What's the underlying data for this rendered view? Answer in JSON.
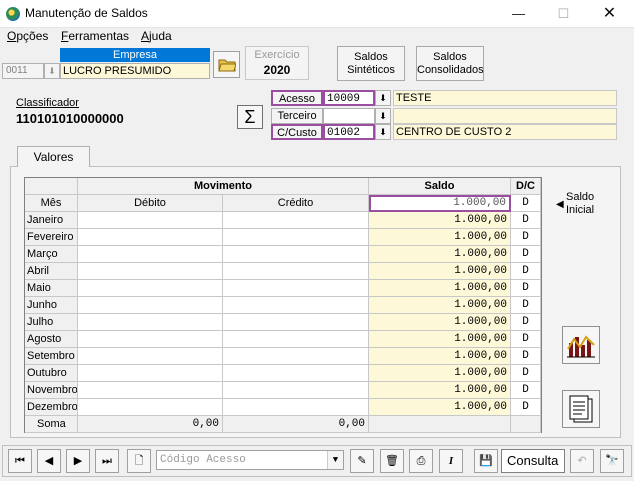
{
  "window": {
    "title": "Manutenção de Saldos",
    "min_symbol": "—",
    "max_symbol": "☐",
    "close_symbol": "✕"
  },
  "menu": {
    "items": [
      {
        "first": "O",
        "rest": "pções"
      },
      {
        "first": "F",
        "rest": "erramentas"
      },
      {
        "first": "A",
        "rest": "juda"
      }
    ]
  },
  "empresa": {
    "header": "Empresa",
    "code": "0011",
    "name": "LUCRO PRESUMIDO"
  },
  "exercicio": {
    "label": "Exercício",
    "value": "2020"
  },
  "buttons": {
    "saldos_sinteticos": [
      "Saldos",
      "Sintéticos"
    ],
    "saldos_consolidados": [
      "Saldos",
      "Consolidados"
    ]
  },
  "classificador": {
    "label": "Classificador",
    "value": "110101010000000",
    "sigma": "Σ"
  },
  "fields": {
    "acesso": {
      "label": "Acesso",
      "value": "10009",
      "desc": "TESTE"
    },
    "terceiro": {
      "label": "Terceiro",
      "value": "",
      "desc": ""
    },
    "ccusto": {
      "label": "C/Custo",
      "value": "01002",
      "desc": "CENTRO DE CUSTO 2"
    }
  },
  "tabs": {
    "valores": "Valores"
  },
  "grid": {
    "group_headers": {
      "movimento": "Movimento",
      "saldo": "Saldo",
      "dc": "D/C"
    },
    "columns": {
      "mes": "Mês",
      "debito": "Débito",
      "credito": "Crédito"
    },
    "saldo_inicial": {
      "saldo": "1.000,00",
      "dc": "D"
    },
    "rows": [
      {
        "mes": "Janeiro",
        "debito": "",
        "credito": "",
        "saldo": "1.000,00",
        "dc": "D"
      },
      {
        "mes": "Fevereiro",
        "debito": "",
        "credito": "",
        "saldo": "1.000,00",
        "dc": "D"
      },
      {
        "mes": "Março",
        "debito": "",
        "credito": "",
        "saldo": "1.000,00",
        "dc": "D"
      },
      {
        "mes": "Abril",
        "debito": "",
        "credito": "",
        "saldo": "1.000,00",
        "dc": "D"
      },
      {
        "mes": "Maio",
        "debito": "",
        "credito": "",
        "saldo": "1.000,00",
        "dc": "D"
      },
      {
        "mes": "Junho",
        "debito": "",
        "credito": "",
        "saldo": "1.000,00",
        "dc": "D"
      },
      {
        "mes": "Julho",
        "debito": "",
        "credito": "",
        "saldo": "1.000,00",
        "dc": "D"
      },
      {
        "mes": "Agosto",
        "debito": "",
        "credito": "",
        "saldo": "1.000,00",
        "dc": "D"
      },
      {
        "mes": "Setembro",
        "debito": "",
        "credito": "",
        "saldo": "1.000,00",
        "dc": "D"
      },
      {
        "mes": "Outubro",
        "debito": "",
        "credito": "",
        "saldo": "1.000,00",
        "dc": "D"
      },
      {
        "mes": "Novembro",
        "debito": "",
        "credito": "",
        "saldo": "1.000,00",
        "dc": "D"
      },
      {
        "mes": "Dezembro",
        "debito": "",
        "credito": "",
        "saldo": "1.000,00",
        "dc": "D"
      }
    ],
    "soma": {
      "label": "Soma",
      "debito": "0,00",
      "credito": "0,00"
    }
  },
  "saldo_inicial_label": [
    "Saldo",
    "Inicial"
  ],
  "toolbar": {
    "codigo_placeholder": "Código Acesso",
    "modo": "Consulta"
  },
  "colors": {
    "highlight": "#9b4ea0",
    "yellow_field": "#fdf8d8",
    "accent": "#0078d7"
  }
}
